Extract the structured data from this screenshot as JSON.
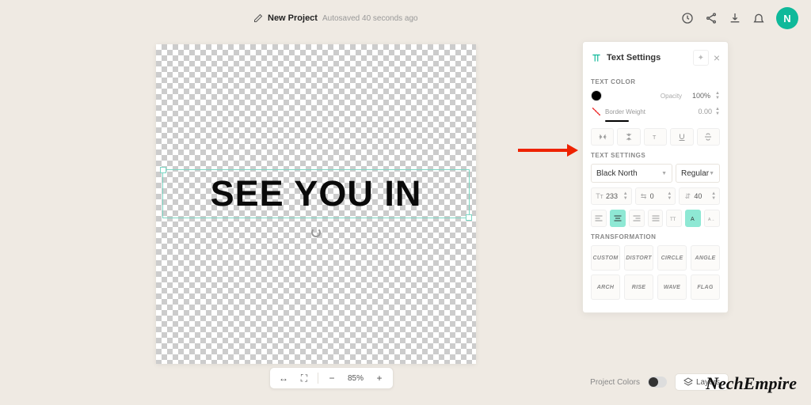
{
  "header": {
    "project_name": "New Project",
    "autosave": "Autosaved 40 seconds ago",
    "avatar_initial": "N"
  },
  "canvas": {
    "text": "SEE YOU IN"
  },
  "zoom": {
    "value": "85%"
  },
  "panel": {
    "title": "Text Settings",
    "text_color_label": "TEXT COLOR",
    "opacity_label": "Opacity",
    "opacity_value": "100%",
    "border_weight_label": "Border Weight",
    "border_weight_value": "0.00",
    "settings_label": "TEXT SETTINGS",
    "font_name": "Black North",
    "font_weight": "Regular",
    "size_value": "233",
    "spacing_value": "0",
    "lineheight_value": "40",
    "transformation_label": "TRANSFORMATION",
    "transforms": [
      "CUSTOM",
      "DISTORT",
      "CIRCLE",
      "ANGLE",
      "ARCH",
      "RISE",
      "WAVE",
      "FLAG"
    ]
  },
  "footer": {
    "project_colors": "Project Colors",
    "layers": "Layers"
  },
  "watermark": "NechEmpire"
}
